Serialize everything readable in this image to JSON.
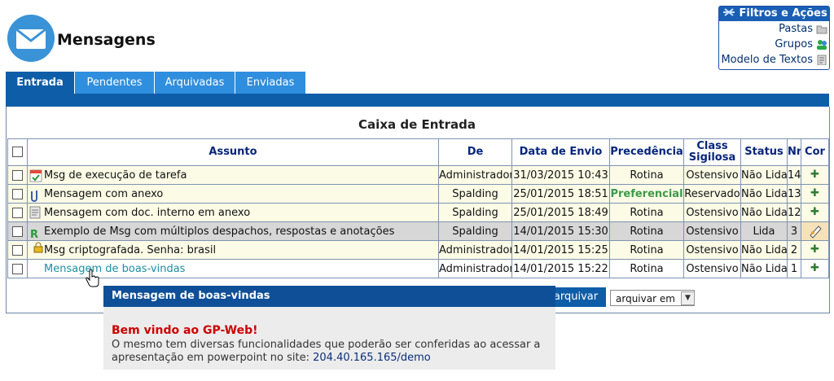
{
  "header": {
    "title": "Mensagens"
  },
  "filters": {
    "title": "Filtros e Ações",
    "items": [
      "Pastas",
      "Grupos",
      "Modelo de Textos"
    ]
  },
  "tabs": [
    {
      "label": "Entrada",
      "active": true
    },
    {
      "label": "Pendentes",
      "active": false
    },
    {
      "label": "Arquivadas",
      "active": false
    },
    {
      "label": "Enviadas",
      "active": false
    }
  ],
  "inbox": {
    "title": "Caixa de Entrada",
    "columns": {
      "subject": "Assunto",
      "from": "De",
      "date": "Data de Envio",
      "precedence": "Precedência",
      "class": "Class Sigilosa",
      "status": "Status",
      "nr": "Nr",
      "cor": "Cor"
    },
    "rows": [
      {
        "subject": "Msg de execução de tarefa",
        "from": "Administrador",
        "date": "31/03/2015 10:43",
        "precedence": "Rotina",
        "class": "Ostensivo",
        "status": "Não Lida",
        "nr": "14",
        "icon": "task-icon"
      },
      {
        "subject": "Mensagem com anexo",
        "from": "Spalding",
        "date": "25/01/2015 18:51",
        "precedence": "Preferencial",
        "class": "Reservado",
        "status": "Não Lida",
        "nr": "13",
        "icon": "paperclip-icon"
      },
      {
        "subject": "Mensagem com doc. interno em anexo",
        "from": "Spalding",
        "date": "25/01/2015 18:49",
        "precedence": "Rotina",
        "class": "Ostensivo",
        "status": "Não Lida",
        "nr": "12",
        "icon": "document-icon"
      },
      {
        "subject": "Exemplo de Msg com múltiplos despachos, respostas e anotações",
        "from": "Spalding",
        "date": "14/01/2015 15:30",
        "precedence": "Rotina",
        "class": "Ostensivo",
        "status": "Lida",
        "nr": "3",
        "icon": "reply-icon"
      },
      {
        "subject": "Msg criptografada. Senha: brasil",
        "from": "Administrador",
        "date": "14/01/2015 15:25",
        "precedence": "Rotina",
        "class": "Ostensivo",
        "status": "Não Lida",
        "nr": "2",
        "icon": "lock-icon"
      },
      {
        "subject": "Mensagem de boas-vindas",
        "from": "Administrador",
        "date": "14/01/2015 15:22",
        "precedence": "Rotina",
        "class": "Ostensivo",
        "status": "Não Lida",
        "nr": "1",
        "icon": ""
      }
    ]
  },
  "actions": {
    "archive_label": "arquivar",
    "archive_select_value": "arquivar em"
  },
  "tooltip": {
    "header": "Mensagem de boas-vindas",
    "title": "Bem vindo ao GP-Web!",
    "text": "O mesmo tem diversas funcionalidades que poderão ser conferidas ao acessar a apresentação em powerpoint no site:",
    "link": "204.40.165.165/demo"
  },
  "colors": {
    "tab_active": "#0e5da8",
    "tab": "#2f8ede",
    "header_text": "#06267a",
    "row_unread": "#fcfbe6",
    "row_read": "#d7d7d7",
    "preferential": "#3c9a4a",
    "tooltip_title": "#cc0000"
  }
}
